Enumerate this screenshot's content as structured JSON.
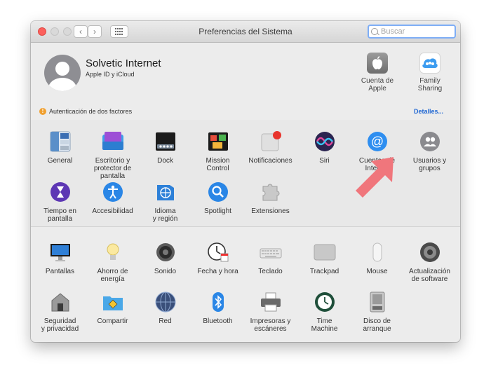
{
  "window": {
    "title": "Preferencias del Sistema"
  },
  "search": {
    "placeholder": "Buscar"
  },
  "account": {
    "name": "Solvetic Internet",
    "subtitle": "Apple ID y iCloud"
  },
  "account_buttons": [
    {
      "label": "Cuenta de\nApple",
      "icon": "apple-logo-icon"
    },
    {
      "label": "Family\nSharing",
      "icon": "family-sharing-icon"
    }
  ],
  "notice": {
    "text": "Autenticación de dos factores",
    "link": "Detalles..."
  },
  "panes_personal": [
    {
      "label": "General",
      "icon": "general-icon"
    },
    {
      "label": "Escritorio y\nprotector de pantalla",
      "icon": "desktop-icon"
    },
    {
      "label": "Dock",
      "icon": "dock-icon"
    },
    {
      "label": "Mission\nControl",
      "icon": "mission-control-icon"
    },
    {
      "label": "Notificaciones",
      "icon": "notifications-icon"
    },
    {
      "label": "Siri",
      "icon": "siri-icon"
    },
    {
      "label": "Cuentas de\nInternet",
      "icon": "internet-accounts-icon"
    },
    {
      "label": "Usuarios y\ngrupos",
      "icon": "users-groups-icon"
    },
    {
      "label": "Tiempo en pantalla",
      "icon": "screen-time-icon"
    },
    {
      "label": "Accesibilidad",
      "icon": "accessibility-icon"
    },
    {
      "label": "Idioma\ny región",
      "icon": "language-region-icon"
    },
    {
      "label": "Spotlight",
      "icon": "spotlight-icon"
    },
    {
      "label": "Extensiones",
      "icon": "extensions-icon"
    }
  ],
  "panes_hardware": [
    {
      "label": "Pantallas",
      "icon": "displays-icon"
    },
    {
      "label": "Ahorro de\nenergía",
      "icon": "energy-saver-icon"
    },
    {
      "label": "Sonido",
      "icon": "sound-icon"
    },
    {
      "label": "Fecha y hora",
      "icon": "date-time-icon"
    },
    {
      "label": "Teclado",
      "icon": "keyboard-icon"
    },
    {
      "label": "Trackpad",
      "icon": "trackpad-icon"
    },
    {
      "label": "Mouse",
      "icon": "mouse-icon"
    },
    {
      "label": "Actualización\nde software",
      "icon": "software-update-icon"
    },
    {
      "label": "Seguridad\ny privacidad",
      "icon": "security-privacy-icon"
    },
    {
      "label": "Compartir",
      "icon": "sharing-icon"
    },
    {
      "label": "Red",
      "icon": "network-icon"
    },
    {
      "label": "Bluetooth",
      "icon": "bluetooth-icon"
    },
    {
      "label": "Impresoras y\nescáneres",
      "icon": "printers-icon"
    },
    {
      "label": "Time\nMachine",
      "icon": "time-machine-icon"
    },
    {
      "label": "Disco de\narranque",
      "icon": "startup-disk-icon"
    }
  ],
  "colors": {
    "accent": "#2168d3",
    "highlight_arrow": "#f0767c",
    "warning": "#f0a030"
  }
}
